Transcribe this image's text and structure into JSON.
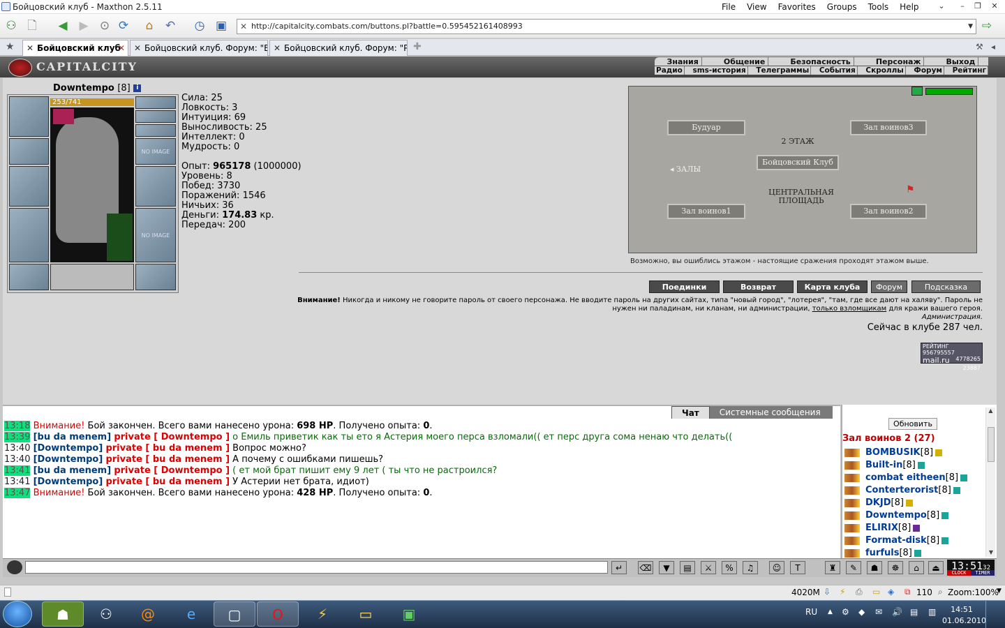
{
  "window": {
    "title": "Бойцовский клуб - Maxthon 2.5.11",
    "menu": [
      "File",
      "View",
      "Favorites",
      "Groups",
      "Tools",
      "Help"
    ]
  },
  "browser": {
    "address": "http://capitalcity.combats.com/buttons.pl?battle=0.595452161408993",
    "tabs": [
      {
        "label": "Бойцовский клуб",
        "active": true
      },
      {
        "label": "Бойцовский клуб. Форум: \"Б...",
        "active": false
      },
      {
        "label": "Бойцовский клуб. Форум: \"Р...",
        "active": false
      }
    ]
  },
  "game": {
    "logo": "CAPITALCITY",
    "nav_top": [
      "Знания",
      "Общение",
      "Безопасность",
      "Персонаж",
      "Выход"
    ],
    "nav_bottom": [
      "Радио",
      "sms-история",
      "Телеграммы",
      "События",
      "Скроллы",
      "Форум",
      "Рейтинг"
    ],
    "character": {
      "name": "Downtempo",
      "level": "[8]",
      "hp": "253/741",
      "no_image": "NO IMAGE"
    },
    "stats": {
      "sila": "Сила: 25",
      "lovkost": "Ловкость: 3",
      "intuicia": "Интуиция: 69",
      "vynoslivost": "Выносливость: 25",
      "intellekt": "Интеллект: 0",
      "mudrost": "Мудрость: 0",
      "opyt_label": "Опыт: ",
      "opyt_value": "965178",
      "opyt_next": " (1000000)",
      "uroven": "Уровень: 8",
      "pobed": "Побед: 3730",
      "porazheniy": "Поражений: 1546",
      "nichyih": "Ничьих: 36",
      "dengi_label": "Деньги: ",
      "dengi_value": "174.83",
      "dengi_unit": " кр.",
      "peredach": "Передач: 200"
    },
    "map": {
      "rooms": [
        "Будуар",
        "Зал воинов3",
        "2 ЭТАЖ",
        "Бойцовский Клуб",
        "ЗАЛЫ",
        "ЦЕНТРАЛЬНАЯ ПЛОЩАДЬ",
        "Зал воинов1",
        "Зал воинов2"
      ],
      "hint": "Возможно, вы ошиблись этажом - настоящие сражения проходят этажом выше."
    },
    "buttons": [
      "Поединки",
      "Возврат",
      "Карта клуба",
      "Форум",
      "Подсказка"
    ],
    "warning": {
      "bold": "Внимание!",
      "text1": " Никогда и никому не говорите пароль от своего персонажа. Не вводите пароль на других сайтах, типа \"новый город\", \"лотерея\", \"там, где все дают на халяву\". Пароль не нужен ни паладинам, ни кланам, ни администрации, ",
      "link": "только взломщикам",
      "text2": " для кражи вашего героя.",
      "sign": "Администрация."
    },
    "online": "Сейчас в клубе 287 чел.",
    "counter": {
      "top": "РЕЙТИНГ 956795557",
      "mid": "4778265",
      "brand": "mail.ru",
      "bottom": "23887"
    }
  },
  "chat": {
    "tabs": [
      "Чат",
      "Системные сообщения"
    ],
    "lines": [
      {
        "t": "13:18",
        "hl": true,
        "parts": [
          {
            "c": "red",
            "s": "Внимание!"
          },
          {
            "c": "",
            "s": " Бой закончен. Всего вами нанесено урона: "
          },
          {
            "c": "b",
            "s": "698 HP"
          },
          {
            "c": "",
            "s": ". Получено опыта: "
          },
          {
            "c": "b",
            "s": "0"
          },
          {
            "c": "",
            "s": "."
          }
        ]
      },
      {
        "t": "13:39",
        "hl": true,
        "parts": [
          {
            "c": "nav",
            "s": "[bu da menem]"
          },
          {
            "c": "",
            "s": " "
          },
          {
            "c": "redb",
            "s": "private [ Downtempo ]"
          },
          {
            "c": "grn",
            "s": " о Емиль приветик как ты ето я Астерия моего перса взломали(( ет перс друга сома ненаю что делать(("
          }
        ]
      },
      {
        "t": "13:40",
        "hl": false,
        "parts": [
          {
            "c": "nav",
            "s": "[Downtempo]"
          },
          {
            "c": "",
            "s": " "
          },
          {
            "c": "redb",
            "s": "private [ bu da menem ]"
          },
          {
            "c": "",
            "s": " Вопрос можно?"
          }
        ]
      },
      {
        "t": "13:40",
        "hl": false,
        "parts": [
          {
            "c": "nav",
            "s": "[Downtempo]"
          },
          {
            "c": "",
            "s": " "
          },
          {
            "c": "redb",
            "s": "private [ bu da menem ]"
          },
          {
            "c": "",
            "s": " А почему с ошибками пишешь?"
          }
        ]
      },
      {
        "t": "13:41",
        "hl": true,
        "parts": [
          {
            "c": "nav",
            "s": "[bu da menem]"
          },
          {
            "c": "",
            "s": " "
          },
          {
            "c": "redb",
            "s": "private [ Downtempo ]"
          },
          {
            "c": "grn",
            "s": " ( ет мой брат пишит ему 9 лет ( ты что не растроился?"
          }
        ]
      },
      {
        "t": "13:41",
        "hl": false,
        "parts": [
          {
            "c": "nav",
            "s": "[Downtempo]"
          },
          {
            "c": "",
            "s": " "
          },
          {
            "c": "redb",
            "s": "private [ bu da menem ]"
          },
          {
            "c": "",
            "s": " У Астерии нет брата, идиот)"
          }
        ]
      },
      {
        "t": "13:47",
        "hl": true,
        "parts": [
          {
            "c": "red",
            "s": "Внимание!"
          },
          {
            "c": "",
            "s": " Бой закончен. Всего вами нанесено урона: "
          },
          {
            "c": "b",
            "s": "428 HP"
          },
          {
            "c": "",
            "s": ". Получено опыта: "
          },
          {
            "c": "b",
            "s": "0"
          },
          {
            "c": "",
            "s": "."
          }
        ]
      }
    ]
  },
  "room": {
    "refresh": "Обновить",
    "title": "Зал воинов 2 (27)",
    "users": [
      {
        "name": "BOMBUSIK",
        "lvl": "[8]",
        "badge": "#d4b000"
      },
      {
        "name": "Built-in",
        "lvl": "[8]",
        "badge": "#1aa59a"
      },
      {
        "name": "combat eitheen",
        "lvl": "[8]",
        "badge": "#1aa59a"
      },
      {
        "name": "Conterterorist",
        "lvl": "[8]",
        "badge": "#1aa59a"
      },
      {
        "name": "DKJD",
        "lvl": "[8]",
        "badge": "#d4b000"
      },
      {
        "name": "Downtempo",
        "lvl": "[8]",
        "badge": "#1aa59a"
      },
      {
        "name": "ELIRIX",
        "lvl": "[8]",
        "badge": "#6a2a9a"
      },
      {
        "name": "Format-disk",
        "lvl": "[8]",
        "badge": "#1aa59a"
      },
      {
        "name": "furfuls",
        "lvl": "[8]",
        "badge": "#1aa59a"
      }
    ]
  },
  "clock_widget": {
    "time": "13:51",
    "secs": "32",
    "labels": [
      "CLOCK",
      "TIMER"
    ]
  },
  "statusbar": {
    "mem": "4020M",
    "count": "110",
    "zoom": "Zoom:100%"
  },
  "taskbar": {
    "lang": "RU",
    "time": "14:51",
    "date": "01.06.2010"
  }
}
